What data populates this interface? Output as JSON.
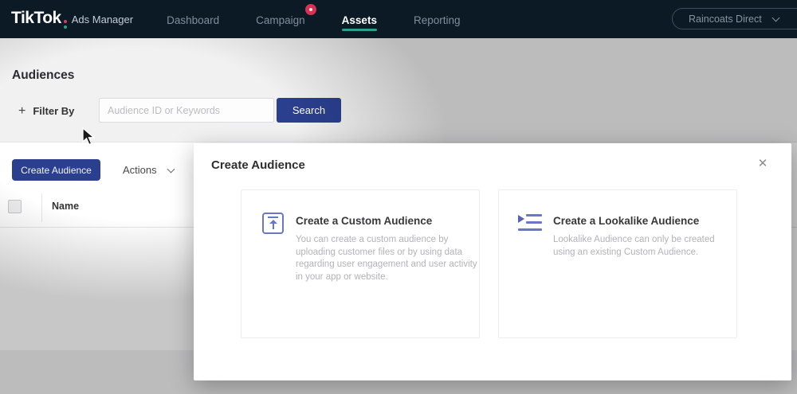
{
  "nav": {
    "brand": {
      "logo": "TikTok",
      "suffix": "Ads Manager"
    },
    "items": [
      {
        "label": "Dashboard"
      },
      {
        "label": "Campaign"
      },
      {
        "label": "Assets"
      },
      {
        "label": "Reporting"
      }
    ],
    "active_item": "Assets",
    "account": {
      "label": "Raincoats Direct"
    }
  },
  "page": {
    "title": "Audiences",
    "filter_button_label": "Filter By",
    "plus_glyph": "+",
    "search_placeholder": "Audience ID or Keywords",
    "search_button_label": "Search",
    "create_button_label": "Create Audience",
    "actions_button_label": "Actions",
    "table": {
      "columns": [
        "Name"
      ]
    }
  },
  "modal": {
    "title": "Create Audience",
    "close_glyph": "✕",
    "options": [
      {
        "icon": "upload-icon",
        "title": "Create a Custom Audience",
        "description": "You can create a custom audience by uploading customer files or by using data regarding user engagement and user activity in your app or website."
      },
      {
        "icon": "lookalike-icon",
        "title": "Create a Lookalike Audience",
        "description": "Lookalike Audience can only be created using an existing Custom Audience."
      }
    ]
  },
  "colors": {
    "nav_background": "#0c1a26",
    "primary_button": "#2b3f8f",
    "active_tab_underline": "#2aa18e",
    "notification_badge": "#d63353",
    "modal_icon_accent": "#6a77c5",
    "brand_colon_top": "#e0395c",
    "brand_colon_bottom": "#2aa18e"
  }
}
